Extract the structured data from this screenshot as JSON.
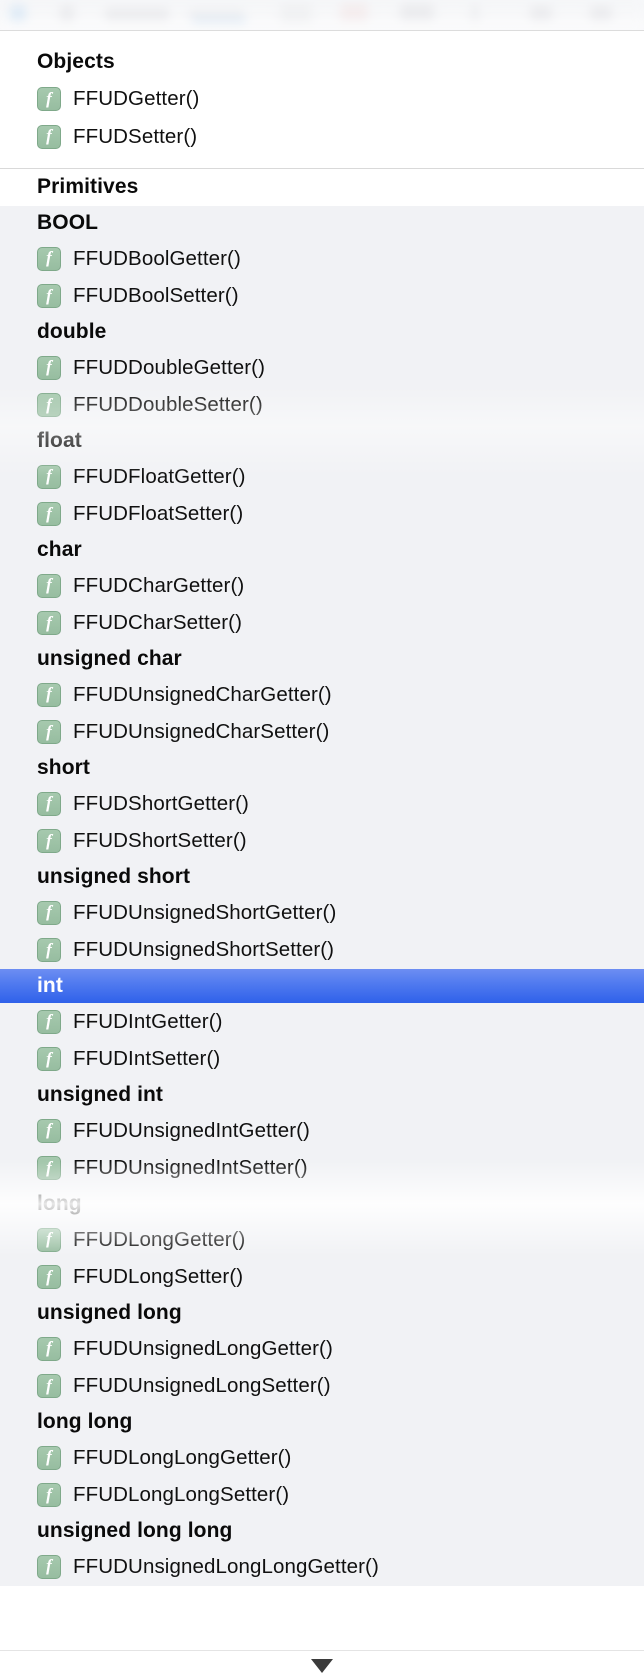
{
  "window": {
    "scroll_up_arrow": "▲",
    "scroll_down_arrow": "▼"
  },
  "list": {
    "groups": [
      {
        "title": "Objects",
        "background": "#ffffff",
        "items": [
          {
            "kind": "function",
            "icon": "function-icon",
            "icon_glyph": "f",
            "label": "FFUDGetter()"
          },
          {
            "kind": "function",
            "icon": "function-icon",
            "icon_glyph": "f",
            "label": "FFUDSetter()"
          }
        ]
      },
      {
        "title": "Primitives",
        "background": "#f1f2f5",
        "items": [
          {
            "kind": "type",
            "label": "BOOL",
            "selected": false
          },
          {
            "kind": "function",
            "icon": "function-icon",
            "icon_glyph": "f",
            "label": "FFUDBoolGetter()"
          },
          {
            "kind": "function",
            "icon": "function-icon",
            "icon_glyph": "f",
            "label": "FFUDBoolSetter()"
          },
          {
            "kind": "type",
            "label": "double",
            "selected": false
          },
          {
            "kind": "function",
            "icon": "function-icon",
            "icon_glyph": "f",
            "label": "FFUDDoubleGetter()"
          },
          {
            "kind": "function",
            "icon": "function-icon",
            "icon_glyph": "f",
            "label": "FFUDDoubleSetter()"
          },
          {
            "kind": "type",
            "label": "float",
            "selected": false
          },
          {
            "kind": "function",
            "icon": "function-icon",
            "icon_glyph": "f",
            "label": "FFUDFloatGetter()"
          },
          {
            "kind": "function",
            "icon": "function-icon",
            "icon_glyph": "f",
            "label": "FFUDFloatSetter()"
          },
          {
            "kind": "type",
            "label": "char",
            "selected": false
          },
          {
            "kind": "function",
            "icon": "function-icon",
            "icon_glyph": "f",
            "label": "FFUDCharGetter()"
          },
          {
            "kind": "function",
            "icon": "function-icon",
            "icon_glyph": "f",
            "label": "FFUDCharSetter()"
          },
          {
            "kind": "type",
            "label": "unsigned char",
            "selected": false
          },
          {
            "kind": "function",
            "icon": "function-icon",
            "icon_glyph": "f",
            "label": "FFUDUnsignedCharGetter()"
          },
          {
            "kind": "function",
            "icon": "function-icon",
            "icon_glyph": "f",
            "label": "FFUDUnsignedCharSetter()"
          },
          {
            "kind": "type",
            "label": "short",
            "selected": false
          },
          {
            "kind": "function",
            "icon": "function-icon",
            "icon_glyph": "f",
            "label": "FFUDShortGetter()"
          },
          {
            "kind": "function",
            "icon": "function-icon",
            "icon_glyph": "f",
            "label": "FFUDShortSetter()"
          },
          {
            "kind": "type",
            "label": "unsigned short",
            "selected": false
          },
          {
            "kind": "function",
            "icon": "function-icon",
            "icon_glyph": "f",
            "label": "FFUDUnsignedShortGetter()"
          },
          {
            "kind": "function",
            "icon": "function-icon",
            "icon_glyph": "f",
            "label": "FFUDUnsignedShortSetter()"
          },
          {
            "kind": "type",
            "label": "int",
            "selected": true
          },
          {
            "kind": "function",
            "icon": "function-icon",
            "icon_glyph": "f",
            "label": "FFUDIntGetter()"
          },
          {
            "kind": "function",
            "icon": "function-icon",
            "icon_glyph": "f",
            "label": "FFUDIntSetter()"
          },
          {
            "kind": "type",
            "label": "unsigned int",
            "selected": false
          },
          {
            "kind": "function",
            "icon": "function-icon",
            "icon_glyph": "f",
            "label": "FFUDUnsignedIntGetter()"
          },
          {
            "kind": "function",
            "icon": "function-icon",
            "icon_glyph": "f",
            "label": "FFUDUnsignedIntSetter()"
          },
          {
            "kind": "type",
            "label": "long",
            "selected": false
          },
          {
            "kind": "function",
            "icon": "function-icon",
            "icon_glyph": "f",
            "label": "FFUDLongGetter()"
          },
          {
            "kind": "function",
            "icon": "function-icon",
            "icon_glyph": "f",
            "label": "FFUDLongSetter()"
          },
          {
            "kind": "type",
            "label": "unsigned long",
            "selected": false
          },
          {
            "kind": "function",
            "icon": "function-icon",
            "icon_glyph": "f",
            "label": "FFUDUnsignedLongGetter()"
          },
          {
            "kind": "function",
            "icon": "function-icon",
            "icon_glyph": "f",
            "label": "FFUDUnsignedLongSetter()"
          },
          {
            "kind": "type",
            "label": "long long",
            "selected": false
          },
          {
            "kind": "function",
            "icon": "function-icon",
            "icon_glyph": "f",
            "label": "FFUDLongLongGetter()"
          },
          {
            "kind": "function",
            "icon": "function-icon",
            "icon_glyph": "f",
            "label": "FFUDLongLongSetter()"
          },
          {
            "kind": "type",
            "label": "unsigned long long",
            "selected": false
          },
          {
            "kind": "function",
            "icon": "function-icon",
            "icon_glyph": "f",
            "label": "FFUDUnsignedLongLongGetter()"
          }
        ]
      }
    ]
  },
  "colors": {
    "selection_blue": "#4f79ef",
    "selection_text": "#ffffff",
    "list_background": "#f1f2f5",
    "group_background": "#ffffff",
    "function_icon_green": "#9cc0a5",
    "text": "#101010"
  }
}
